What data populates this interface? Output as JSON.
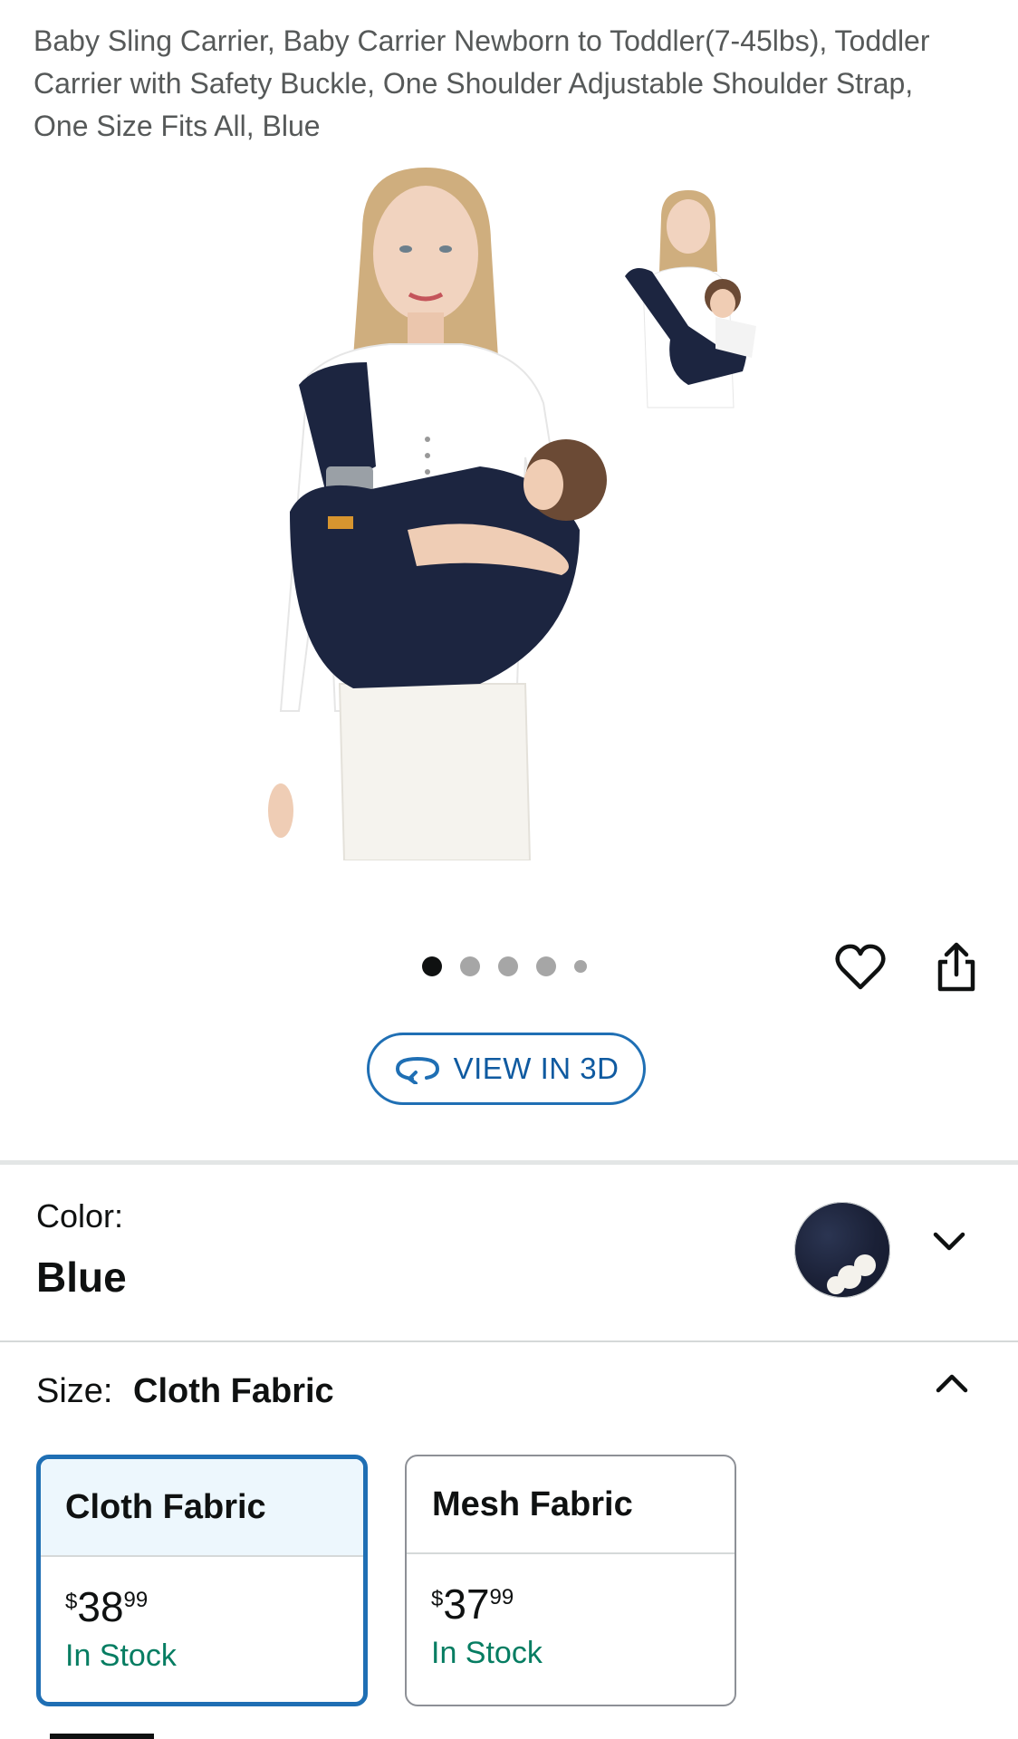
{
  "product": {
    "title": "Baby Sling Carrier, Baby Carrier Newborn to Toddler(7-45lbs), Toddler Carrier with Safety Buckle, One Shoulder Adjustable Shoulder Strap, One Size Fits All, Blue"
  },
  "gallery": {
    "image_count": 5,
    "active_index": 0
  },
  "actions": {
    "favorite_icon": "heart-outline-icon",
    "share_icon": "share-icon",
    "view_3d_label": "VIEW IN 3D",
    "view_3d_icon": "rotate-3d-icon"
  },
  "color": {
    "label": "Color:",
    "value": "Blue"
  },
  "size": {
    "label": "Size:",
    "value": "Cloth Fabric",
    "options": [
      {
        "name": "Cloth Fabric",
        "currency": "$",
        "whole": "38",
        "fraction": "99",
        "stock": "In Stock",
        "selected": true
      },
      {
        "name": "Mesh Fabric",
        "currency": "$",
        "whole": "37",
        "fraction": "99",
        "stock": "In Stock",
        "selected": false
      }
    ]
  },
  "colors": {
    "accent": "#1f6fb4",
    "in_stock": "#067d62",
    "sling_navy": "#1c2540"
  }
}
